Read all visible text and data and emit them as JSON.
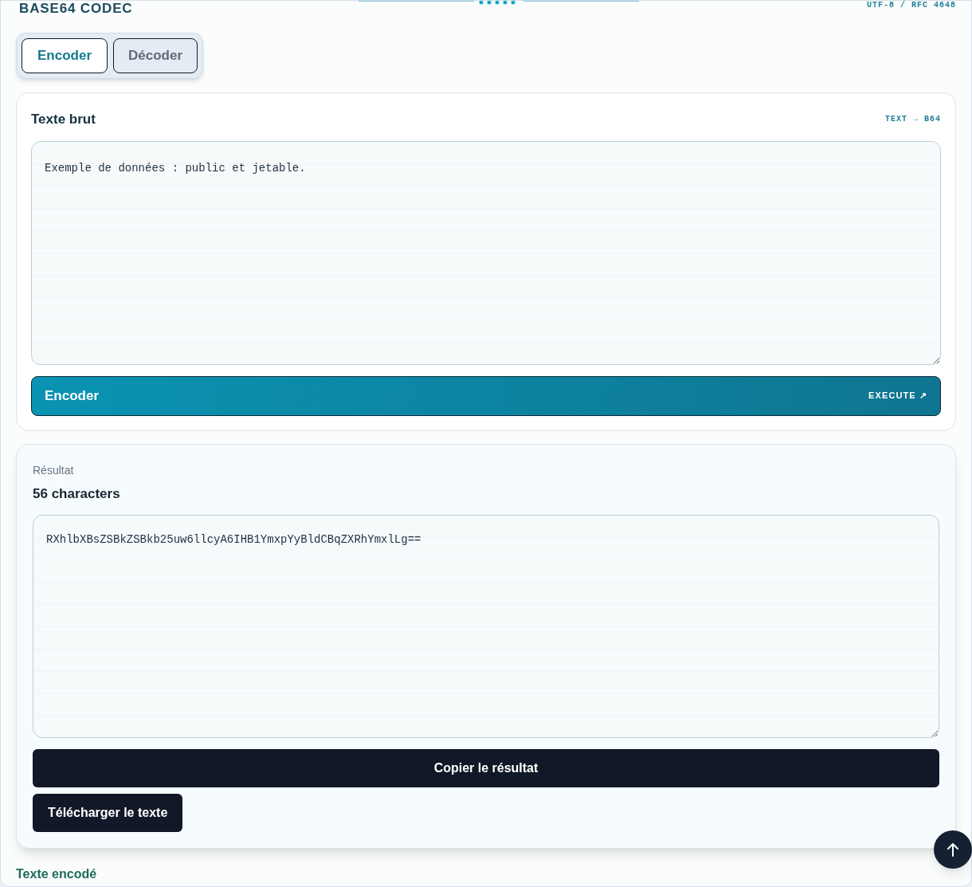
{
  "header": {
    "title": "BASE64 CODEC",
    "standard": "UTF-8 / RFC 4648"
  },
  "tabs": [
    {
      "label": "Encoder",
      "selected": true
    },
    {
      "label": "Décoder",
      "selected": false
    }
  ],
  "input_card": {
    "title": "Texte brut",
    "direction": "TEXT → B64",
    "value": "Exemple de données : public et jetable.",
    "action": {
      "label": "Encoder",
      "hint": "EXECUTE ↗"
    }
  },
  "result_card": {
    "label": "Résultat",
    "count": "56 characters",
    "value": "RXhlbXBsZSBkZSBkb25uw6llcyA6IHB1YmxpYyBldCBqZXRhYmxlLg==",
    "buttons": [
      "Copier le résultat",
      "Télécharger le texte"
    ]
  },
  "footer": {
    "label": "Texte encodé"
  }
}
